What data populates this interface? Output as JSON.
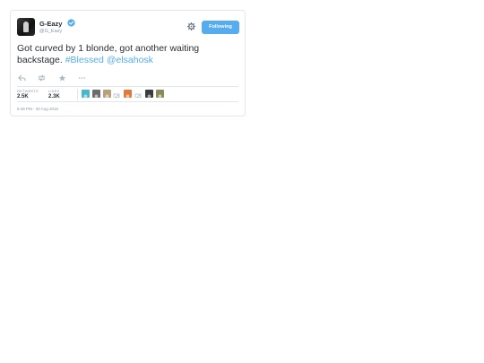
{
  "tweet": {
    "author": {
      "display_name": "G-Eazy",
      "handle": "@G_Eazy",
      "verified": true,
      "verified_color": "#55acee"
    },
    "follow_button_label": "Following",
    "text_parts": {
      "plain": "Got curved by 1 blonde, got another waiting backstage. ",
      "hashtag": "#Blessed",
      "space": " ",
      "mention": "@elsahosk"
    },
    "stats": {
      "retweets_label": "RETWEETS",
      "retweets_value": "2.5K",
      "likes_label": "LIKES",
      "likes_value": "2.3K"
    },
    "likers": [
      {
        "icon": "avatar-icon",
        "color": "#4ab7c9"
      },
      {
        "icon": "avatar-icon",
        "color": "#6b6b6b"
      },
      {
        "icon": "avatar-icon",
        "color": "#b7a07a"
      },
      {
        "icon": "broken-image-icon",
        "color": "#ffffff"
      },
      {
        "icon": "avatar-icon",
        "color": "#e07a3c"
      },
      {
        "icon": "broken-image-icon",
        "color": "#ffffff"
      },
      {
        "icon": "avatar-icon",
        "color": "#3c3c3c"
      },
      {
        "icon": "avatar-icon",
        "color": "#8a8a5a"
      }
    ],
    "timestamp": "6:49 PM - 30 Aug 2016",
    "actions": [
      "reply-icon",
      "retweet-icon",
      "like-star-icon",
      "more-icon"
    ]
  },
  "colors": {
    "link": "#55acee",
    "muted": "#8899a6",
    "border": "#e1e8ed",
    "text": "#292f33"
  }
}
